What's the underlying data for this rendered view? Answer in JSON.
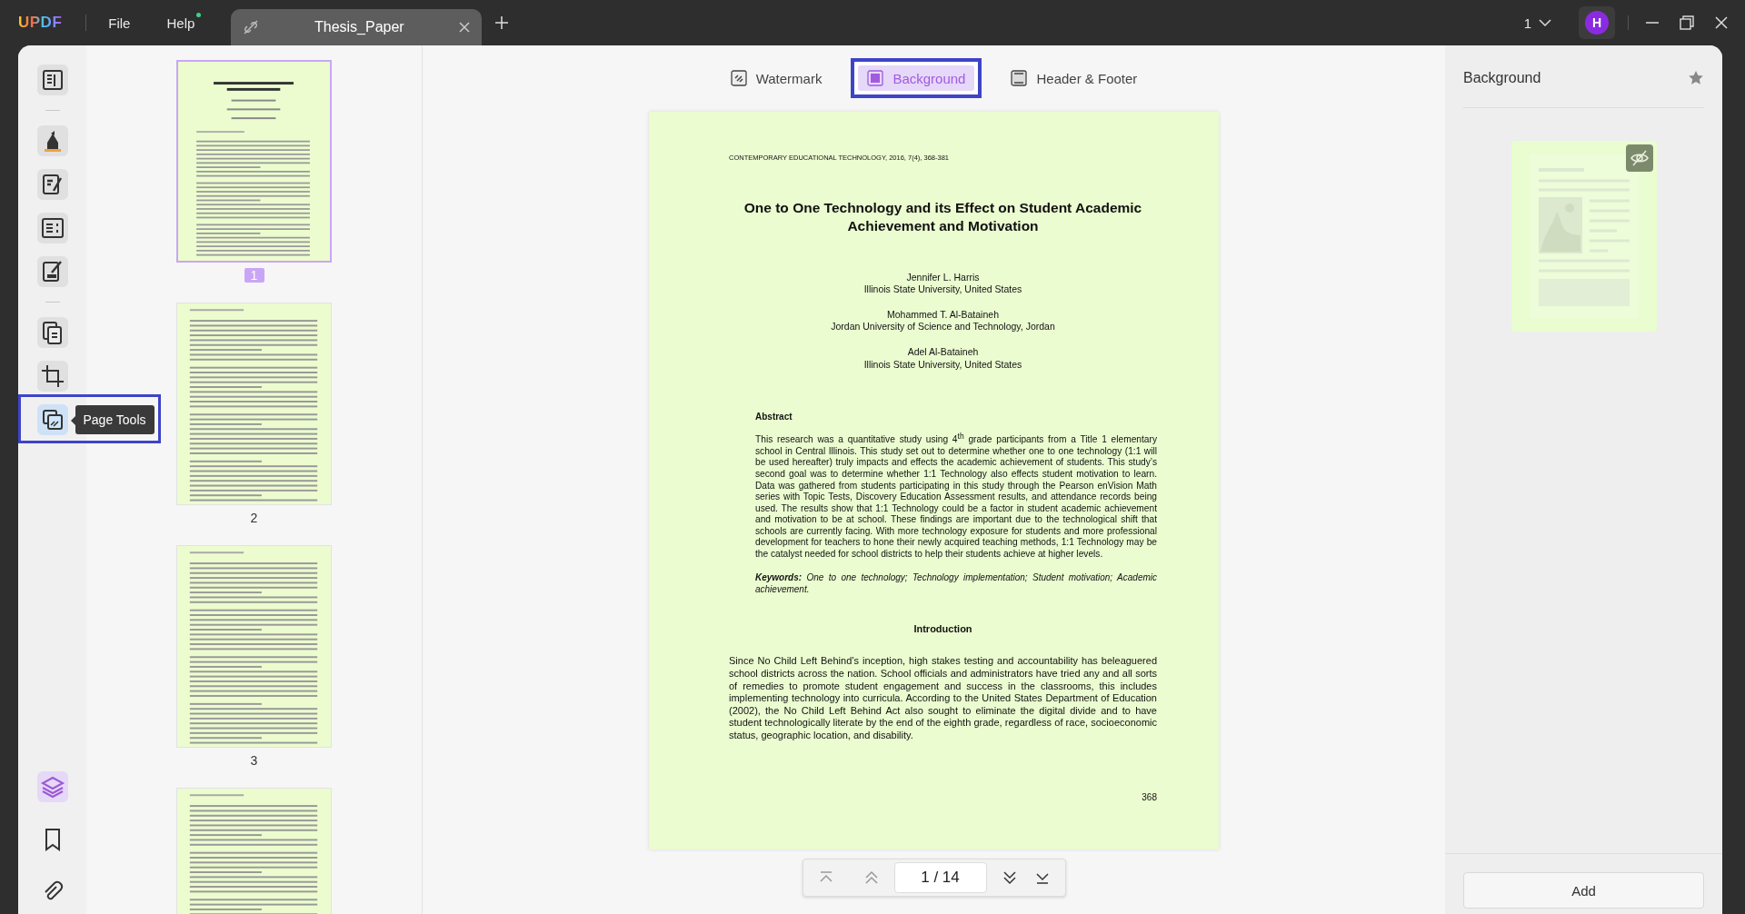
{
  "app": {
    "logo": "UPDF",
    "menus": [
      {
        "label": "File"
      },
      {
        "label": "Help",
        "dot": true
      }
    ]
  },
  "tabs": [
    {
      "label": "Thesis_Paper",
      "selected": true
    }
  ],
  "page_selector": "1",
  "avatar": "H",
  "tool_rail": {
    "tooltip": "Page Tools",
    "items": [
      {
        "kind": "reader",
        "selected": false
      },
      {
        "kind": "separator"
      },
      {
        "kind": "highlighter",
        "selected": false
      },
      {
        "kind": "edit",
        "selected": false
      },
      {
        "kind": "form",
        "selected": false
      },
      {
        "kind": "sign",
        "selected": false
      },
      {
        "kind": "separator"
      },
      {
        "kind": "organize",
        "selected": false
      },
      {
        "kind": "crop",
        "selected": false
      },
      {
        "kind": "page-tools",
        "selected": true,
        "highlighted": true
      }
    ],
    "bottom_items": [
      {
        "kind": "layers",
        "selected": true
      },
      {
        "kind": "bookmark",
        "selected": false
      },
      {
        "kind": "attachment",
        "selected": false
      }
    ]
  },
  "thumbnails": [
    {
      "label": "1",
      "selected": true
    },
    {
      "label": "2",
      "selected": false
    },
    {
      "label": "3",
      "selected": false
    },
    {
      "selected": false
    }
  ],
  "tool_tabs": [
    {
      "label": "Watermark",
      "kind": "watermark",
      "selected": false
    },
    {
      "label": "Background",
      "kind": "background",
      "selected": true,
      "highlighted": true
    },
    {
      "label": "Header & Footer",
      "kind": "header-footer",
      "selected": false
    }
  ],
  "document": {
    "running_head": "CONTEMPORARY EDUCATIONAL TECHNOLOGY, 2016, 7(4), 368-381",
    "title": "One to One Technology and its Effect on Student Academic Achievement and Motivation",
    "authors": [
      {
        "name": "Jennifer L. Harris",
        "affiliation": "Illinois State University, United States"
      },
      {
        "name": "Mohammed T. Al-Bataineh",
        "affiliation": "Jordan University of Science and Technology, Jordan"
      },
      {
        "name": "Adel Al-Bataineh",
        "affiliation": "Illinois State University, United States"
      }
    ],
    "abstract_heading": "Abstract",
    "abstract": "This research was a quantitative study using 4$^{th}$ grade participants from a Title 1 elementary school in Central Illinois.  This study set out to determine whether one to one technology (1:1 will be used hereafter) truly impacts and effects the academic achievement of students.  This study’s second goal was to determine whether 1:1 Technology also effects student motivation to learn.  Data was gathered from students participating in this study through the Pearson enVision Math series with Topic Tests, Discovery Education Assessment results, and attendance records being used.  The results show that 1:1 Technology could be a factor in student academic achievement and motivation to be at school.  These findings are important due to the technological shift that schools are currently facing.  With more technology exposure for students and more professional development for teachers to hone their newly acquired teaching methods, 1:1 Technology may be the catalyst needed for school districts to help their students achieve at higher levels.",
    "keywords": {
      "label": "Keywords:",
      "text": "One to one technology; Technology implementation; Student motivation; Academic achievement."
    },
    "intro_heading": "Introduction",
    "intro": "Since No Child Left Behind’s inception, high stakes testing and accountability has beleaguered school districts across the nation.  School officials and administrators have tried any and all sorts of remedies to promote student engagement and success in the classrooms, this includes implementing technology into curricula.  According to the United States Department of Education (2002), the No Child Left Behind Act also sought to eliminate the digital divide and to have student technologically literate by the end of the eighth grade, regardless of race, socioeconomic status, geographic location, and disability.",
    "page_number": "368"
  },
  "page_nav": {
    "page_field": "1 / 14"
  },
  "side_panel": {
    "title": "Background",
    "template": {
      "hidden": true
    },
    "add_button": "Add"
  }
}
